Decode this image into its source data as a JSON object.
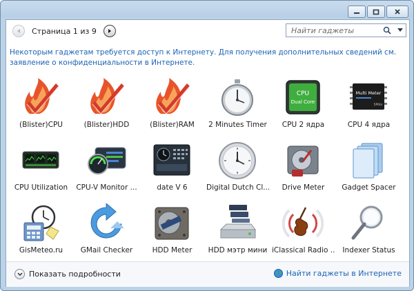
{
  "window": {
    "controls": {
      "minimize": "minimize",
      "maximize": "maximize",
      "close": "close"
    }
  },
  "nav": {
    "page_label": "Страница 1 из 9"
  },
  "search": {
    "placeholder": "Найти гаджеты"
  },
  "notice": "Некоторым гаджетам требуется доступ к Интернету. Для получения дополнительных сведений см. заявление о конфиденциальности в Интернете.",
  "gadgets": [
    {
      "label": "(Blister)CPU",
      "icon": "flame-checkmark-icon"
    },
    {
      "label": "(Blister)HDD",
      "icon": "flame-checkmark-icon"
    },
    {
      "label": "(Blister)RAM",
      "icon": "flame-checkmark-icon"
    },
    {
      "label": "2 Minutes Timer",
      "icon": "stopwatch-icon"
    },
    {
      "label": "CPU 2 ядра",
      "icon": "cpu-chip-icon",
      "chip_text": [
        "CPU",
        "Dual Core"
      ]
    },
    {
      "label": "CPU 4 ядра",
      "icon": "multi-meter-chip-icon",
      "chip_text": [
        "Multi Meter",
        "5Ptits"
      ]
    },
    {
      "label": "CPU Utilization",
      "icon": "cpu-graph-icon"
    },
    {
      "label": "CPU-V Monitor ...",
      "icon": "cpu-monitor-gauge-icon"
    },
    {
      "label": "date V 6",
      "icon": "calendar-clock-icon"
    },
    {
      "label": "Digital Dutch Cl...",
      "icon": "wall-clock-icon"
    },
    {
      "label": "Drive Meter",
      "icon": "hard-drive-icon"
    },
    {
      "label": "Gadget Spacer",
      "icon": "stacked-pages-icon"
    },
    {
      "label": "GisMeteo.ru",
      "icon": "clock-calculator-icon"
    },
    {
      "label": "GMail Checker",
      "icon": "refresh-arrow-icon"
    },
    {
      "label": "HDD Meter",
      "icon": "hdd-disk-icon"
    },
    {
      "label": "HDD мэтр мини",
      "icon": "server-stack-icon"
    },
    {
      "label": "iClassical Radio ...",
      "icon": "violin-radio-icon"
    },
    {
      "label": "Indexer Status",
      "icon": "magnifier-icon"
    }
  ],
  "footer": {
    "details_label": "Показать подробности",
    "online_label": "Найти гаджеты в Интернете"
  },
  "colors": {
    "link": "#1b63b5",
    "frame": "#bcd2e8",
    "flame": "#e8542a",
    "checkmark": "#d23b2b"
  }
}
